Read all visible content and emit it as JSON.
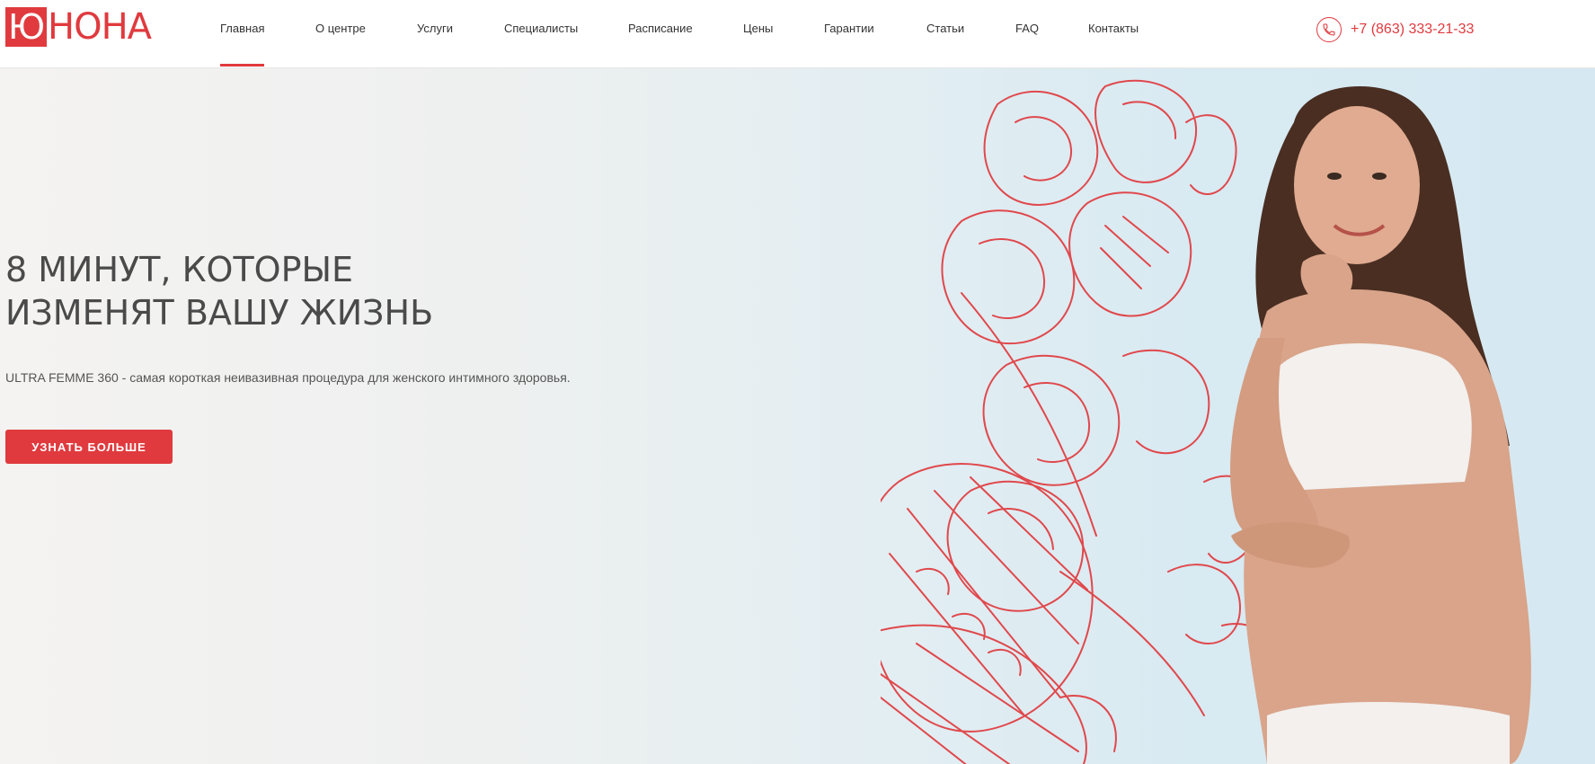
{
  "header": {
    "logo": {
      "first_letter": "Ю",
      "rest": "НОНА"
    },
    "nav": [
      {
        "label": "Главная",
        "active": true
      },
      {
        "label": "О центре",
        "active": false
      },
      {
        "label": "Услуги",
        "active": false
      },
      {
        "label": "Специалисты",
        "active": false
      },
      {
        "label": "Расписание",
        "active": false
      },
      {
        "label": "Цены",
        "active": false
      },
      {
        "label": "Гарантии",
        "active": false
      },
      {
        "label": "Статьи",
        "active": false
      },
      {
        "label": "FAQ",
        "active": false
      },
      {
        "label": "Контакты",
        "active": false
      }
    ],
    "phone": {
      "icon": "phone-icon",
      "number": "+7 (863) 333-21-33"
    }
  },
  "hero": {
    "title_line1": "8 МИНУТ, КОТОРЫЕ",
    "title_line2": "ИЗМЕНЯТ ВАШУ ЖИЗНЬ",
    "subtitle": "ULTRA FEMME 360 - самая короткая неивазивная процедура для женского интимного здоровья.",
    "button_label": "УЗНАТЬ БОЛЬШЕ"
  },
  "colors": {
    "accent": "#e03a3e",
    "text": "#4a4a4a",
    "hero_bg_left": "#f4f3f1",
    "hero_bg_right": "#d6e9f2"
  }
}
